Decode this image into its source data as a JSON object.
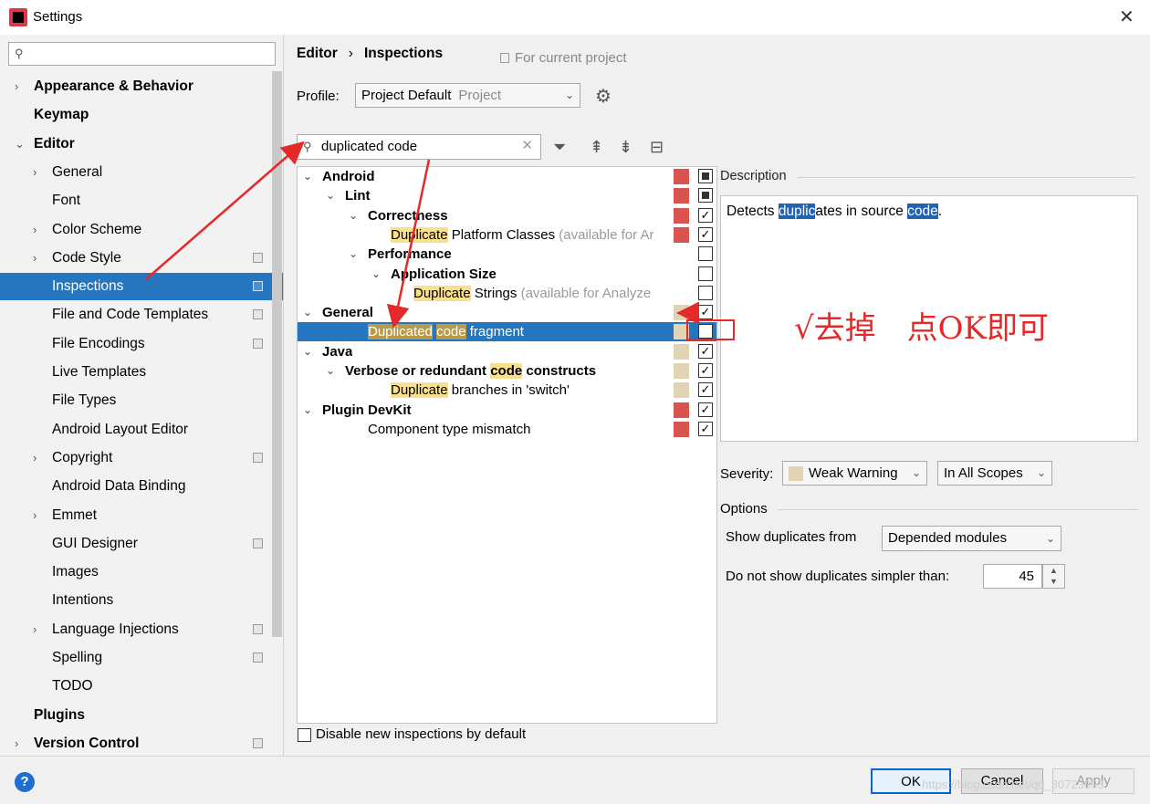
{
  "window": {
    "title": "Settings",
    "close": "✕"
  },
  "sidebar": {
    "search_icon": "magnifier-icon",
    "items": [
      {
        "label": "Appearance & Behavior",
        "level": 0,
        "bold": true,
        "chevron": "›",
        "proj": false
      },
      {
        "label": "Keymap",
        "level": 0,
        "bold": true,
        "chevron": "",
        "proj": false
      },
      {
        "label": "Editor",
        "level": 0,
        "bold": true,
        "chevron": "⌄",
        "proj": false
      },
      {
        "label": "General",
        "level": 1,
        "bold": false,
        "chevron": "›",
        "proj": false
      },
      {
        "label": "Font",
        "level": 1,
        "bold": false,
        "chevron": "",
        "proj": false
      },
      {
        "label": "Color Scheme",
        "level": 1,
        "bold": false,
        "chevron": "›",
        "proj": false
      },
      {
        "label": "Code Style",
        "level": 1,
        "bold": false,
        "chevron": "›",
        "proj": true
      },
      {
        "label": "Inspections",
        "level": 1,
        "bold": false,
        "chevron": "",
        "proj": true,
        "selected": true
      },
      {
        "label": "File and Code Templates",
        "level": 1,
        "bold": false,
        "chevron": "",
        "proj": true
      },
      {
        "label": "File Encodings",
        "level": 1,
        "bold": false,
        "chevron": "",
        "proj": true
      },
      {
        "label": "Live Templates",
        "level": 1,
        "bold": false,
        "chevron": "",
        "proj": false
      },
      {
        "label": "File Types",
        "level": 1,
        "bold": false,
        "chevron": "",
        "proj": false
      },
      {
        "label": "Android Layout Editor",
        "level": 1,
        "bold": false,
        "chevron": "",
        "proj": false
      },
      {
        "label": "Copyright",
        "level": 1,
        "bold": false,
        "chevron": "›",
        "proj": true
      },
      {
        "label": "Android Data Binding",
        "level": 1,
        "bold": false,
        "chevron": "",
        "proj": false
      },
      {
        "label": "Emmet",
        "level": 1,
        "bold": false,
        "chevron": "›",
        "proj": false
      },
      {
        "label": "GUI Designer",
        "level": 1,
        "bold": false,
        "chevron": "",
        "proj": true
      },
      {
        "label": "Images",
        "level": 1,
        "bold": false,
        "chevron": "",
        "proj": false
      },
      {
        "label": "Intentions",
        "level": 1,
        "bold": false,
        "chevron": "",
        "proj": false
      },
      {
        "label": "Language Injections",
        "level": 1,
        "bold": false,
        "chevron": "›",
        "proj": true
      },
      {
        "label": "Spelling",
        "level": 1,
        "bold": false,
        "chevron": "",
        "proj": true
      },
      {
        "label": "TODO",
        "level": 1,
        "bold": false,
        "chevron": "",
        "proj": false
      },
      {
        "label": "Plugins",
        "level": 0,
        "bold": true,
        "chevron": "",
        "proj": false
      },
      {
        "label": "Version Control",
        "level": 0,
        "bold": true,
        "chevron": "›",
        "proj": true
      }
    ]
  },
  "header": {
    "crumb_parent": "Editor",
    "crumb_sep": "›",
    "crumb_current": "Inspections",
    "for_current_project": "For current project"
  },
  "profile": {
    "label": "Profile:",
    "value": "Project Default",
    "scope": "Project"
  },
  "filter": {
    "value": "duplicated code",
    "clear": "✕"
  },
  "tree_rows": [
    {
      "level": 0,
      "arrow": "⌄",
      "bold": true,
      "parts": [
        {
          "t": "Android"
        }
      ],
      "color": "#d9534f",
      "check": "partial"
    },
    {
      "level": 1,
      "arrow": "⌄",
      "bold": true,
      "parts": [
        {
          "t": "Lint"
        }
      ],
      "color": "#d9534f",
      "check": "partial"
    },
    {
      "level": 2,
      "arrow": "⌄",
      "bold": true,
      "parts": [
        {
          "t": "Correctness"
        }
      ],
      "color": "#d9534f",
      "check": "checked"
    },
    {
      "level": 3,
      "arrow": "",
      "bold": false,
      "parts": [
        {
          "t": "Duplicate",
          "hl": true
        },
        {
          "t": " Platform Classes "
        },
        {
          "t": "(available for Ar",
          "muted": true
        }
      ],
      "color": "#d9534f",
      "check": "checked"
    },
    {
      "level": 2,
      "arrow": "⌄",
      "bold": true,
      "parts": [
        {
          "t": "Performance"
        }
      ],
      "color": "",
      "check": "unchecked"
    },
    {
      "level": 3,
      "arrow": "⌄",
      "bold": true,
      "parts": [
        {
          "t": "Application Size"
        }
      ],
      "color": "",
      "check": "unchecked"
    },
    {
      "level": 4,
      "arrow": "",
      "bold": false,
      "parts": [
        {
          "t": "Duplicate",
          "hl": true
        },
        {
          "t": " Strings "
        },
        {
          "t": "(available for Analyze",
          "muted": true
        }
      ],
      "color": "",
      "check": "unchecked"
    },
    {
      "level": 0,
      "arrow": "⌄",
      "bold": true,
      "parts": [
        {
          "t": "General"
        }
      ],
      "color": "#e0d4b4",
      "check": "checked"
    },
    {
      "level": 2,
      "arrow": "",
      "bold": false,
      "parts": [
        {
          "t": "Duplicated",
          "hl": true
        },
        {
          "t": " "
        },
        {
          "t": "code",
          "hl": true
        },
        {
          "t": " fragment"
        }
      ],
      "color": "#e0d4b4",
      "check": "checked",
      "selected": true
    },
    {
      "level": 0,
      "arrow": "⌄",
      "bold": true,
      "parts": [
        {
          "t": "Java"
        }
      ],
      "color": "#e0d4b4",
      "check": "checked"
    },
    {
      "level": 1,
      "arrow": "⌄",
      "bold": true,
      "parts": [
        {
          "t": "Verbose or redundant "
        },
        {
          "t": "code",
          "hl": true
        },
        {
          "t": " constructs"
        }
      ],
      "color": "#e0d4b4",
      "check": "checked"
    },
    {
      "level": 3,
      "arrow": "",
      "bold": false,
      "parts": [
        {
          "t": "Duplicate",
          "hl": true
        },
        {
          "t": " branches in 'switch'"
        }
      ],
      "color": "#e0d4b4",
      "check": "checked"
    },
    {
      "level": 0,
      "arrow": "⌄",
      "bold": true,
      "parts": [
        {
          "t": "Plugin DevKit"
        }
      ],
      "color": "#d9534f",
      "check": "checked"
    },
    {
      "level": 2,
      "arrow": "",
      "bold": false,
      "parts": [
        {
          "t": "Component type mismatch"
        }
      ],
      "color": "#d9534f",
      "check": "checked"
    }
  ],
  "disable_new": "Disable new inspections by default",
  "description": {
    "label": "Description",
    "parts": [
      {
        "t": "Detects "
      },
      {
        "t": "duplic",
        "sel": true
      },
      {
        "t": "ates in source "
      },
      {
        "t": "code",
        "sel": true
      },
      {
        "t": "."
      }
    ]
  },
  "annotation": {
    "note": "√去掉　点OK即可",
    "arrow_color": "#e52929"
  },
  "severity": {
    "label": "Severity:",
    "value": "Weak Warning",
    "scope": "In All Scopes",
    "color": "#e0d4b4"
  },
  "options": {
    "label": "Options",
    "show_dup_label": "Show duplicates from",
    "show_dup_value": "Depended modules",
    "simpler_label": "Do not show duplicates simpler than:",
    "simpler_value": "45"
  },
  "buttons": {
    "ok": "OK",
    "cancel": "Cancel",
    "apply": "Apply",
    "help": "?"
  },
  "watermark": "https://blog.csdn.net/qq_30723093"
}
